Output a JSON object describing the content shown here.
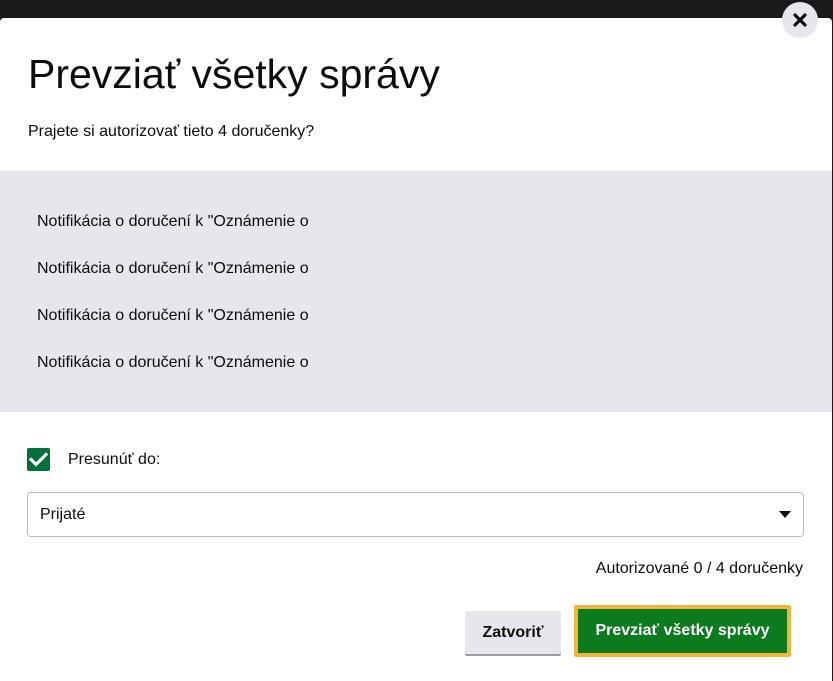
{
  "dialog": {
    "title": "Prevziať všetky správy",
    "subtitle": "Prajete si autorizovať tieto 4 doručenky?",
    "close_icon": "close-icon",
    "items": [
      {
        "label": "Notifikácia o doručení k \"Oznámenie o"
      },
      {
        "label": "Notifikácia o doručení k \"Oznámenie o"
      },
      {
        "label": "Notifikácia o doručení k \"Oznámenie o"
      },
      {
        "label": "Notifikácia o doručení k \"Oznámenie o"
      }
    ],
    "move_checkbox": {
      "checked": true,
      "label": "Presunúť do:"
    },
    "folder_select": {
      "value": "Prijaté"
    },
    "status": "Autorizované 0 / 4 doručenky",
    "buttons": {
      "close_label": "Zatvoriť",
      "confirm_label": "Prevziať všetky správy"
    }
  },
  "colors": {
    "backdrop": "#1a1a1a",
    "list_background": "#e6e7ec",
    "primary_button": "#0c7b1e",
    "focus_ring": "#f6b33e",
    "checkbox": "#00703c"
  }
}
